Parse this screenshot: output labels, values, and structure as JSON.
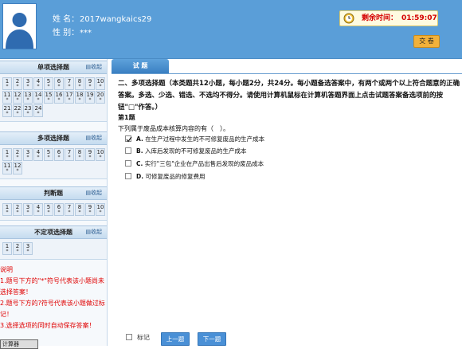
{
  "header": {
    "name_label": "姓 名：",
    "name_value": "2017wangkaics29",
    "gender_label": "性 别：",
    "gender_value": "***",
    "timer_label": "剩余时间：",
    "timer_value": "01:59:07",
    "submit_label": "交 卷"
  },
  "sidebar": {
    "collapse_label": "收起",
    "sections": [
      {
        "title": "单项选择题",
        "items": [
          {
            "n": "1",
            "m": "*"
          },
          {
            "n": "2",
            "m": "*"
          },
          {
            "n": "3",
            "m": "*"
          },
          {
            "n": "4",
            "m": "*"
          },
          {
            "n": "5",
            "m": "*"
          },
          {
            "n": "6",
            "m": "*"
          },
          {
            "n": "7",
            "m": "*"
          },
          {
            "n": "8",
            "m": "*"
          },
          {
            "n": "9",
            "m": "*"
          },
          {
            "n": "10",
            "m": "*"
          },
          {
            "n": "11",
            "m": "*"
          },
          {
            "n": "12",
            "m": "*"
          },
          {
            "n": "13",
            "m": "*"
          },
          {
            "n": "14",
            "m": "*"
          },
          {
            "n": "15",
            "m": "*"
          },
          {
            "n": "16",
            "m": "*"
          },
          {
            "n": "17",
            "m": "*"
          },
          {
            "n": "18",
            "m": "*"
          },
          {
            "n": "19",
            "m": "*"
          },
          {
            "n": "20",
            "m": "*"
          },
          {
            "n": "21",
            "m": "*"
          },
          {
            "n": "22",
            "m": "*"
          },
          {
            "n": "23",
            "m": "*"
          },
          {
            "n": "24",
            "m": "*"
          }
        ]
      },
      {
        "title": "多项选择题",
        "items": [
          {
            "n": "1",
            "m": "*"
          },
          {
            "n": "2",
            "m": "*"
          },
          {
            "n": "3",
            "m": "*"
          },
          {
            "n": "4",
            "m": "*"
          },
          {
            "n": "5",
            "m": "*"
          },
          {
            "n": "6",
            "m": "*"
          },
          {
            "n": "7",
            "m": "*"
          },
          {
            "n": "8",
            "m": "*"
          },
          {
            "n": "9",
            "m": "*"
          },
          {
            "n": "10",
            "m": "*"
          },
          {
            "n": "11",
            "m": "*"
          },
          {
            "n": "12",
            "m": "*"
          }
        ]
      },
      {
        "title": "判断题",
        "items": [
          {
            "n": "1",
            "m": "*"
          },
          {
            "n": "2",
            "m": "*"
          },
          {
            "n": "3",
            "m": "*"
          },
          {
            "n": "4",
            "m": "*"
          },
          {
            "n": "5",
            "m": "*"
          },
          {
            "n": "6",
            "m": "*"
          },
          {
            "n": "7",
            "m": "*"
          },
          {
            "n": "8",
            "m": "*"
          },
          {
            "n": "9",
            "m": "*"
          },
          {
            "n": "10",
            "m": "*"
          }
        ]
      },
      {
        "title": "不定项选择题",
        "items": [
          {
            "n": "1",
            "m": "*"
          },
          {
            "n": "2",
            "m": "*"
          },
          {
            "n": "3",
            "m": "*"
          }
        ]
      }
    ],
    "notes": [
      "说明",
      "1.题号下方的\"*\"符号代表该小题尚未选择答案！",
      "2.题号下方的?符号代表该小题做过标记！",
      "3.选择选项的同时自动保存答案！"
    ],
    "calculator_label": "计算器"
  },
  "main": {
    "tab_label": "试 题",
    "instructions": "二、多项选择题（本类题共12小题，每小题2分，共24分。每小题备选答案中，有两个或两个以上符合题意的正确答案。多选、少选、错选、不选均不得分。请使用计算机鼠标在计算机答题界面上点击试题答案备选项前的按钮\"□\"作答。）",
    "question_number": "第1题",
    "question_text": "下列属于废品成本核算内容的有（　）。",
    "options": [
      {
        "letter": "A.",
        "text": "在生产过程中发生的不可修复废品的生产成本",
        "checked": true
      },
      {
        "letter": "B.",
        "text": "入库后发现的不可修复废品的生产成本",
        "checked": false
      },
      {
        "letter": "C.",
        "text": "实行\"三包\"企业在产品出售后发现的废品成本",
        "checked": false
      },
      {
        "letter": "D.",
        "text": "可修复废品的修复费用",
        "checked": false
      }
    ],
    "mark_label": "标记",
    "prev_label": "上一题",
    "next_label": "下一题"
  }
}
